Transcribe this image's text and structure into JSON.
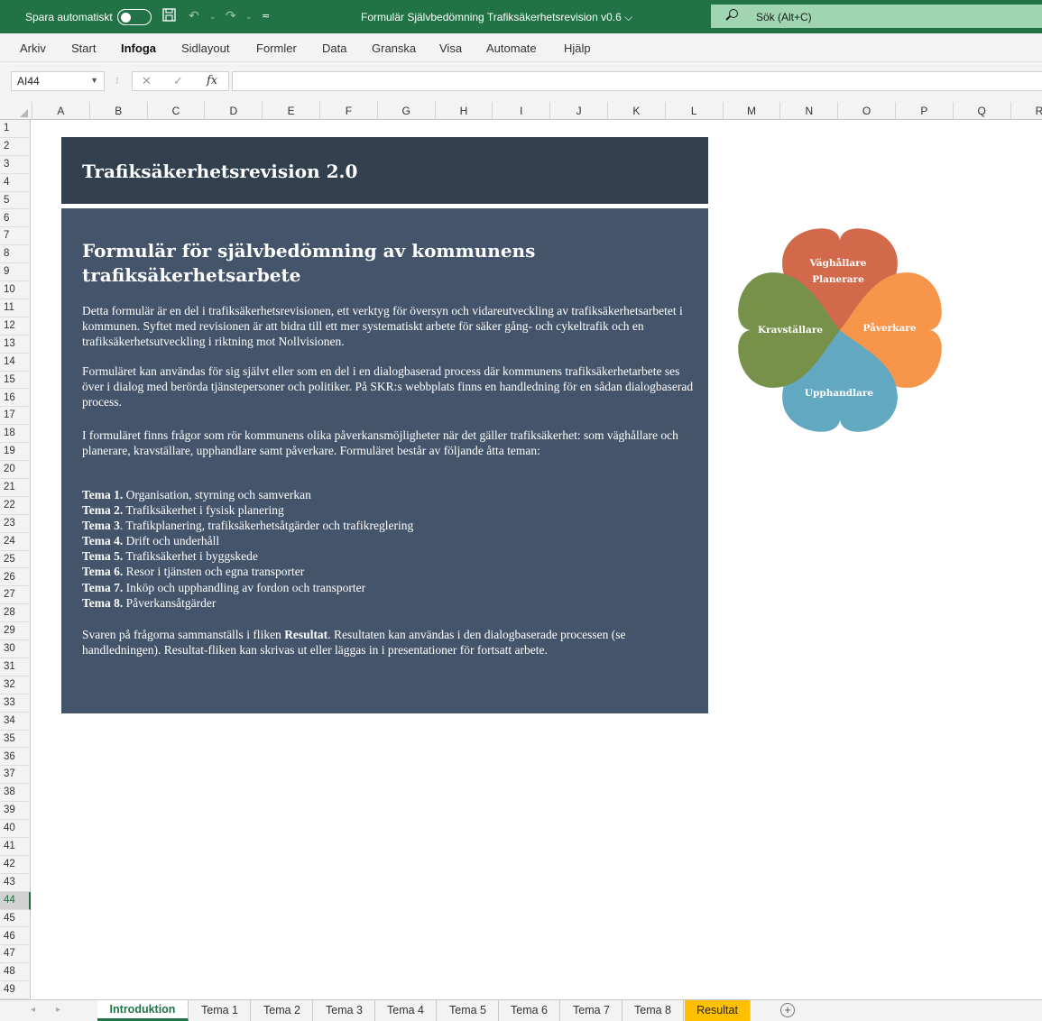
{
  "titlebar": {
    "autosave_label": "Spara automatiskt",
    "autosave_on": false,
    "document_title": "Formulär Självbedömning Trafiksäkerhetsrevision v0.6",
    "search_placeholder": "Sök (Alt+C)",
    "icons": [
      "save-icon",
      "undo-icon",
      "redo-icon",
      "customize-qat-icon",
      "chevron-down-icon",
      "search-icon"
    ]
  },
  "ribbon": {
    "tabs": [
      "Arkiv",
      "Start",
      "Infoga",
      "Sidlayout",
      "Formler",
      "Data",
      "Granska",
      "Visa",
      "Automate",
      "Hjälp"
    ],
    "active_tab": "Infoga"
  },
  "formula_bar": {
    "name_box": "AI44",
    "fx_label": "fx",
    "value": ""
  },
  "columns": [
    "A",
    "B",
    "C",
    "D",
    "E",
    "F",
    "G",
    "H",
    "I",
    "J",
    "K",
    "L",
    "M",
    "N",
    "O",
    "P",
    "Q",
    "R"
  ],
  "rows": [
    "1",
    "2",
    "3",
    "4",
    "5",
    "6",
    "7",
    "8",
    "9",
    "10",
    "11",
    "12",
    "13",
    "14",
    "15",
    "16",
    "17",
    "18",
    "19",
    "20",
    "21",
    "22",
    "23",
    "24",
    "25",
    "26",
    "27",
    "28",
    "29",
    "30",
    "31",
    "32",
    "33",
    "34",
    "35",
    "36",
    "37",
    "38",
    "39",
    "40",
    "41",
    "42",
    "43",
    "44",
    "45",
    "46",
    "47",
    "48",
    "49"
  ],
  "selected_row": "44",
  "title_box": {
    "heading": "Trafiksäkerhetsrevision 2.0",
    "bg": "#323f4f"
  },
  "info_box": {
    "heading": "Formulär för självbedömning av kommunens trafiksäkerhetsarbete",
    "bg": "#44546a",
    "para1": "Detta formulär är en del i trafiksäkerhetsrevisionen, ett verktyg för översyn och vidareutveckling av trafiksäkerhetsarbetet i kommunen. Syftet med revisionen är att bidra till ett mer systematiskt arbete för säker gång- och cykeltrafik och en trafiksäkerhetsutveckling i riktning mot Nollvisionen.",
    "para2": "Formuläret kan användas för sig självt eller som en del i en dialogbaserad process där kommunens trafiksäkerhetarbete ses över i dialog med berörda tjänstepersoner och politiker. På SKR:s webbplats finns en handledning för en sådan dialogbaserad process.",
    "para3": "I formuläret finns frågor som rör kommunens olika påverkansmöjligheter när det gäller trafiksäkerhet: som väghållare och planerare, kravställare, upphandlare samt påverkare. Formuläret består av följande åtta teman:",
    "themes": [
      {
        "label": "Tema 1.",
        "text": " Organisation, styrning och samverkan"
      },
      {
        "label": "Tema 2.",
        "text": " Trafiksäkerhet i fysisk planering"
      },
      {
        "label": "Tema 3",
        "text": ". Trafikplanering, trafiksäkerhetsåtgärder och trafikreglering"
      },
      {
        "label": "Tema 4.",
        "text": " Drift och underhåll"
      },
      {
        "label": "Tema 5.",
        "text": " Trafiksäkerhet i byggskede"
      },
      {
        "label": "Tema 6.",
        "text": " Resor i tjänsten och egna transporter"
      },
      {
        "label": "Tema 7.",
        "text": " Inköp och upphandling av fordon och transporter"
      },
      {
        "label": "Tema 8.",
        "text": " Påverkansåtgärder"
      }
    ],
    "para4_a": "Svaren på frågorna sammanställs i fliken ",
    "para4_bold": "Resultat",
    "para4_b": ". Resultaten kan användas i den dialogbaserade processen (se handledningen). Resultat-fliken kan skrivas ut eller läggas in i presentationer för fortsatt arbete."
  },
  "clover": {
    "top_line1": "Väghållare",
    "top_line2": "Planerare",
    "left": "Kravställare",
    "right": "Påverkare",
    "bottom": "Upphandlare",
    "colors": {
      "top": "#d2694b",
      "left": "#77904a",
      "right": "#f7954a",
      "bottom": "#63a8c1"
    }
  },
  "sheet_tabs": {
    "tabs": [
      "Introduktion",
      "Tema 1",
      "Tema 2",
      "Tema 3",
      "Tema 4",
      "Tema 5",
      "Tema 6",
      "Tema 7",
      "Tema 8",
      "Resultat"
    ],
    "active": "Introduktion",
    "highlighted": "Resultat",
    "add_label": "+"
  }
}
